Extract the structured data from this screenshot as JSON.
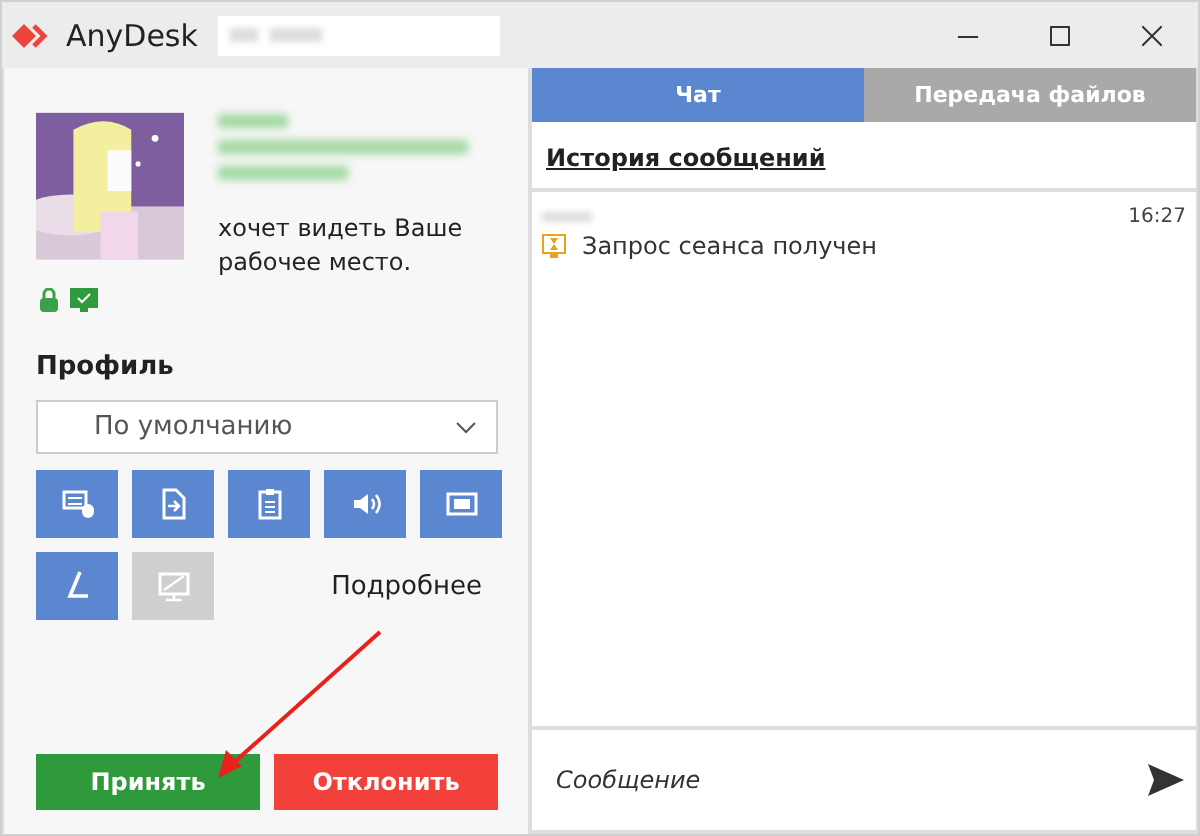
{
  "window": {
    "title": "AnyDesk"
  },
  "request": {
    "message": "хочет видеть Ваше рабочее место."
  },
  "profile": {
    "label": "Профиль",
    "value": "По умолчанию"
  },
  "permissions": [
    {
      "kind": "keyboard",
      "disabled": false
    },
    {
      "kind": "file",
      "disabled": false
    },
    {
      "kind": "clipboard",
      "disabled": false
    },
    {
      "kind": "sound",
      "disabled": false
    },
    {
      "kind": "video",
      "disabled": false
    },
    {
      "kind": "pen",
      "disabled": false
    },
    {
      "kind": "screen",
      "disabled": true
    }
  ],
  "more_link": "Подробнее",
  "actions": [
    {
      "kind": "accept",
      "label": "Принять"
    },
    {
      "kind": "decline",
      "label": "Отклонить"
    }
  ],
  "tabs": [
    {
      "label": "Чат",
      "selected": true
    },
    {
      "label": "Передача файлов",
      "selected": false
    }
  ],
  "chat": {
    "history_title": "История сообщений",
    "messages": [
      {
        "time": "16:27",
        "text": "Запрос сеанса получен"
      }
    ],
    "input": {
      "placeholder": "Сообщение"
    }
  }
}
